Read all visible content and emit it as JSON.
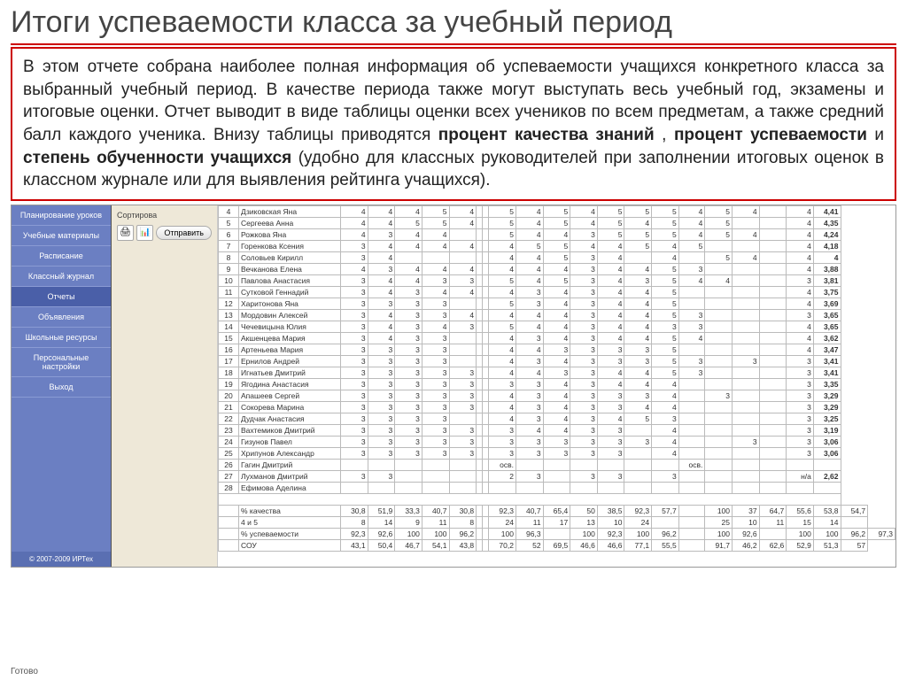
{
  "title": "Итоги успеваемости класса за учебный период",
  "description": {
    "p1": "В этом отчете собрана наиболее полная информация об успеваемости учащихся конкретного класса за выбранный учебный период. В качестве периода также могут выступать весь учебный год, экзамены и итоговые оценки. Отчет выводит в виде таблицы оценки всех учеников по всем предметам, а также средний балл каждого ученика. Внизу таблицы приводятся ",
    "b1": "процент качества знаний",
    "s1": ", ",
    "b2": "процент успеваемости",
    "s2": " и ",
    "b3": "степень обученности учащихся",
    "p2": " (удобно для классных руководителей при заполнении итоговых оценок в классном журнале или для выявления рейтинга учащихся)."
  },
  "sidebar": {
    "items": [
      {
        "label": "Планирование уроков"
      },
      {
        "label": "Учебные материалы"
      },
      {
        "label": "Расписание"
      },
      {
        "label": "Классный журнал"
      },
      {
        "label": "Отчеты"
      },
      {
        "label": "Объявления"
      },
      {
        "label": "Школьные ресурсы"
      },
      {
        "label": "Персональные настройки"
      },
      {
        "label": "Выход"
      }
    ],
    "active_index": 4,
    "copyright": "© 2007-2009 ИРТех"
  },
  "toolpane": {
    "sort_label": "Сортирова",
    "send": "Отправить",
    "print_icon": "🖨",
    "excel_icon": "📊"
  },
  "status_bar": "Готово",
  "chart_data": {
    "type": "table",
    "title": "Итоги успеваемости класса за учебный период",
    "columns_count": 21,
    "rows": [
      {
        "n": 4,
        "name": "Дзиковская Яна",
        "g": [
          4,
          4,
          4,
          5,
          4,
          "",
          "",
          5,
          4,
          5,
          4,
          5,
          5,
          5,
          4,
          5,
          4,
          "",
          4
        ],
        "avg": "4,41"
      },
      {
        "n": 5,
        "name": "Сергеева Анна",
        "g": [
          4,
          4,
          5,
          5,
          4,
          "",
          "",
          5,
          4,
          5,
          4,
          5,
          4,
          5,
          4,
          5,
          "",
          "",
          4
        ],
        "avg": "4,35"
      },
      {
        "n": 6,
        "name": "Рожкова Яна",
        "g": [
          4,
          3,
          4,
          4,
          "",
          "",
          "",
          5,
          4,
          4,
          3,
          5,
          5,
          5,
          4,
          5,
          4,
          "",
          4
        ],
        "avg": "4,24"
      },
      {
        "n": 7,
        "name": "Горенкова Ксения",
        "g": [
          3,
          4,
          4,
          4,
          4,
          "",
          "",
          4,
          5,
          5,
          4,
          4,
          5,
          4,
          5,
          "",
          "",
          "",
          4
        ],
        "avg": "4,18"
      },
      {
        "n": 8,
        "name": "Соловьев Кирилл",
        "g": [
          3,
          4,
          "",
          "",
          "",
          "",
          "",
          4,
          4,
          5,
          3,
          4,
          "",
          4,
          "",
          5,
          4,
          "",
          4
        ],
        "avg": "4"
      },
      {
        "n": 9,
        "name": "Вечканова Елена",
        "g": [
          4,
          3,
          4,
          4,
          4,
          "",
          "",
          4,
          4,
          4,
          3,
          4,
          4,
          5,
          3,
          "",
          "",
          "",
          4
        ],
        "avg": "3,88"
      },
      {
        "n": 10,
        "name": "Павлова Анастасия",
        "g": [
          3,
          4,
          4,
          3,
          3,
          "",
          "",
          5,
          4,
          5,
          3,
          4,
          3,
          5,
          4,
          4,
          "",
          "",
          3
        ],
        "avg": "3,81"
      },
      {
        "n": 11,
        "name": "Сутковой Геннадий",
        "g": [
          3,
          4,
          3,
          4,
          4,
          "",
          "",
          4,
          3,
          4,
          3,
          4,
          4,
          5,
          "",
          "",
          "",
          "",
          4
        ],
        "avg": "3,75"
      },
      {
        "n": 12,
        "name": "Харитонова Яна",
        "g": [
          3,
          3,
          3,
          3,
          "",
          "",
          "",
          5,
          3,
          4,
          3,
          4,
          4,
          5,
          "",
          "",
          "",
          "",
          4
        ],
        "avg": "3,69"
      },
      {
        "n": 13,
        "name": "Мордовин Алексей",
        "g": [
          3,
          4,
          3,
          3,
          4,
          "",
          "",
          4,
          4,
          4,
          3,
          4,
          4,
          5,
          3,
          "",
          "",
          "",
          3
        ],
        "avg": "3,65"
      },
      {
        "n": 14,
        "name": "Чечевицына Юлия",
        "g": [
          3,
          4,
          3,
          4,
          3,
          "",
          "",
          5,
          4,
          4,
          3,
          4,
          4,
          3,
          3,
          "",
          "",
          "",
          4
        ],
        "avg": "3,65"
      },
      {
        "n": 15,
        "name": "Акшенцева Мария",
        "g": [
          3,
          4,
          3,
          3,
          "",
          "",
          "",
          4,
          3,
          4,
          3,
          4,
          4,
          5,
          4,
          "",
          "",
          "",
          4
        ],
        "avg": "3,62"
      },
      {
        "n": 16,
        "name": "Артеньева Мария",
        "g": [
          3,
          3,
          3,
          3,
          "",
          "",
          "",
          4,
          4,
          3,
          3,
          3,
          3,
          5,
          "",
          "",
          "",
          "",
          4
        ],
        "avg": "3,47"
      },
      {
        "n": 17,
        "name": "Ернилов Андрей",
        "g": [
          3,
          3,
          3,
          3,
          "",
          "",
          "",
          4,
          3,
          4,
          3,
          3,
          3,
          5,
          3,
          "",
          3,
          "",
          3
        ],
        "avg": "3,41"
      },
      {
        "n": 18,
        "name": "Игнатьев Дмитрий",
        "g": [
          3,
          3,
          3,
          3,
          3,
          "",
          "",
          4,
          4,
          3,
          3,
          4,
          4,
          5,
          3,
          "",
          "",
          "",
          3
        ],
        "avg": "3,41"
      },
      {
        "n": 19,
        "name": "Ягодина Анастасия",
        "g": [
          3,
          3,
          3,
          3,
          3,
          "",
          "",
          3,
          3,
          4,
          3,
          4,
          4,
          4,
          "",
          "",
          "",
          "",
          3
        ],
        "avg": "3,35"
      },
      {
        "n": 20,
        "name": "Апашеев Сергей",
        "g": [
          3,
          3,
          3,
          3,
          3,
          "",
          "",
          4,
          3,
          4,
          3,
          3,
          3,
          4,
          "",
          3,
          "",
          "",
          3
        ],
        "avg": "3,29"
      },
      {
        "n": 21,
        "name": "Сокорева Марина",
        "g": [
          3,
          3,
          3,
          3,
          3,
          "",
          "",
          4,
          3,
          4,
          3,
          3,
          4,
          4,
          "",
          "",
          "",
          "",
          3
        ],
        "avg": "3,29"
      },
      {
        "n": 22,
        "name": "Дудчак Анастасия",
        "g": [
          3,
          3,
          3,
          3,
          "",
          "",
          "",
          4,
          3,
          4,
          3,
          4,
          5,
          3,
          "",
          "",
          "",
          "",
          3
        ],
        "avg": "3,25"
      },
      {
        "n": 23,
        "name": "Вахтемиков Дмитрий",
        "g": [
          3,
          3,
          3,
          3,
          3,
          "",
          "",
          3,
          4,
          4,
          3,
          3,
          "",
          4,
          "",
          "",
          "",
          "",
          3
        ],
        "avg": "3,19"
      },
      {
        "n": 24,
        "name": "Гизунов Павел",
        "g": [
          3,
          3,
          3,
          3,
          3,
          "",
          "",
          3,
          3,
          3,
          3,
          3,
          3,
          4,
          "",
          "",
          3,
          "",
          3
        ],
        "avg": "3,06"
      },
      {
        "n": 25,
        "name": "Хрипунов Александр",
        "g": [
          3,
          3,
          3,
          3,
          3,
          "",
          "",
          3,
          3,
          3,
          3,
          3,
          "",
          4,
          "",
          "",
          "",
          "",
          3
        ],
        "avg": "3,06"
      },
      {
        "n": 26,
        "name": "Гагин Дмитрий",
        "g": [
          "",
          "",
          "",
          "",
          "",
          "",
          "",
          "осв.",
          "",
          "",
          "",
          "",
          "",
          "",
          "осв.",
          "",
          "",
          "",
          ""
        ],
        "avg": ""
      },
      {
        "n": 27,
        "name": "Лухманов Дмитрий",
        "g": [
          3,
          3,
          "",
          "",
          "",
          "",
          "",
          2,
          3,
          "",
          3,
          3,
          "",
          3,
          "",
          "",
          "",
          "",
          "н/а"
        ],
        "avg": "2,62"
      },
      {
        "n": 28,
        "name": "Ефимова Аделина",
        "g": [
          "",
          "",
          "",
          "",
          "",
          "",
          "",
          "",
          "",
          "",
          "",
          "",
          "",
          "",
          "",
          "",
          "",
          "",
          ""
        ],
        "avg": ""
      }
    ],
    "summary": [
      {
        "label": "% качества",
        "v": [
          "30,8",
          "51,9",
          "33,3",
          "40,7",
          "30,8",
          "",
          "",
          "92,3",
          "40,7",
          "65,4",
          "50",
          "38,5",
          "92,3",
          "57,7",
          "",
          "100",
          "37",
          "64,7",
          "55,6",
          "53,8",
          "54,7"
        ]
      },
      {
        "label": "4 и 5",
        "v": [
          "8",
          "14",
          "9",
          "11",
          "8",
          "",
          "",
          "24",
          "11",
          "17",
          "13",
          "10",
          "24",
          "",
          "",
          "25",
          "10",
          "11",
          "15",
          "14",
          ""
        ]
      },
      {
        "label": "% успеваемости",
        "v": [
          "92,3",
          "92,6",
          "100",
          "100",
          "96,2",
          "",
          "",
          "100",
          "96,3",
          "",
          "100",
          "92,3",
          "100",
          "96,2",
          "",
          "100",
          "92,6",
          "",
          "100",
          "100",
          "96,2",
          "97,3"
        ]
      },
      {
        "label": "СОУ",
        "v": [
          "43,1",
          "50,4",
          "46,7",
          "54,1",
          "43,8",
          "",
          "",
          "70,2",
          "52",
          "69,5",
          "46,6",
          "46,6",
          "77,1",
          "55,5",
          "",
          "91,7",
          "46,2",
          "62,6",
          "52,9",
          "51,3",
          "57"
        ]
      }
    ]
  }
}
